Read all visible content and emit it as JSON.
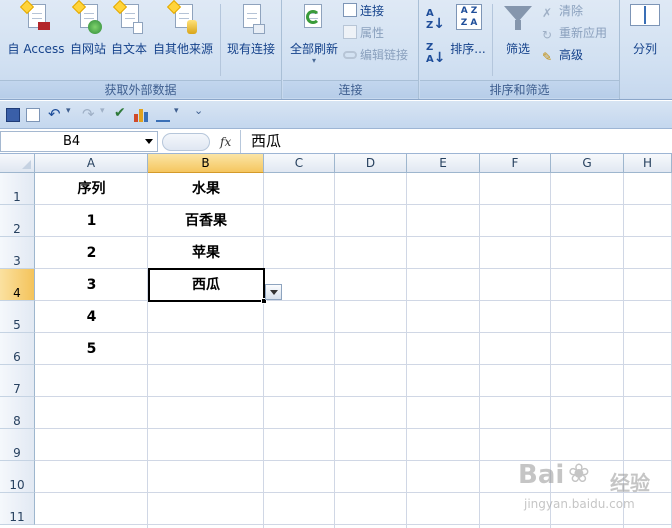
{
  "ribbon": {
    "groups": {
      "external_data": "获取外部数据",
      "connections": "连接",
      "sort_filter": "排序和筛选"
    },
    "buttons": {
      "access": "自 Access",
      "web": "自网站",
      "text": "自文本",
      "other_sources": "自其他来源",
      "existing_connections": "现有连接",
      "refresh_all": "全部刷新",
      "connections": "连接",
      "properties": "属性",
      "edit_links": "编辑链接",
      "sort": "排序...",
      "filter": "筛选",
      "clear": "清除",
      "reapply": "重新应用",
      "advanced": "高级",
      "text_to_columns": "分列"
    },
    "colors": {
      "ribbon_bg": "#d2e1f2",
      "label_text": "#15428b",
      "selected_header": "#f5c65f"
    }
  },
  "formula_bar": {
    "name_box": "B4",
    "fx": "fx",
    "content": "西瓜"
  },
  "sheet": {
    "columns": [
      "A",
      "B",
      "C",
      "D",
      "E",
      "F",
      "G",
      "H"
    ],
    "rows": [
      "1",
      "2",
      "3",
      "4",
      "5",
      "6",
      "7",
      "8",
      "9",
      "10",
      "11"
    ],
    "cells": {
      "A1": "序列",
      "B1": "水果",
      "A2": "1",
      "B2": "百香果",
      "A3": "2",
      "B3": "苹果",
      "A4": "3",
      "B4": "西瓜",
      "A5": "4",
      "A6": "5"
    },
    "active_cell": "B4"
  },
  "watermark": {
    "brand": "Bai",
    "brand_cn": "经验",
    "url": "jingyan.baidu.com"
  }
}
